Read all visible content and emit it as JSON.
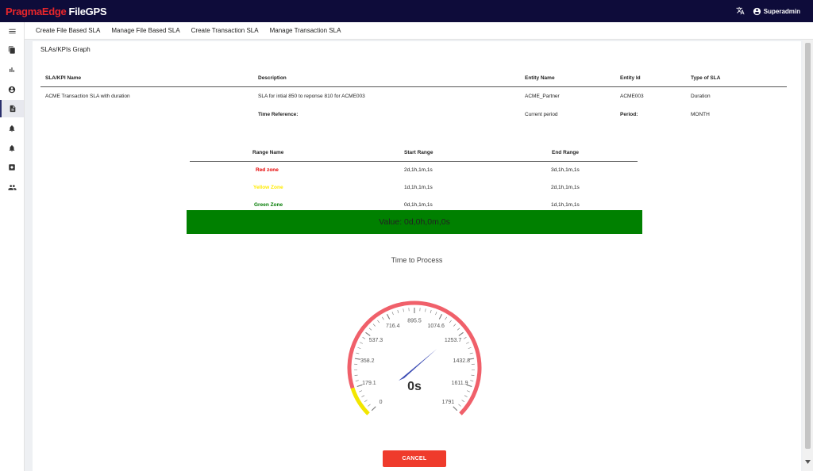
{
  "brand": {
    "part1": "PragmaEdge",
    "part2": "FileGPS"
  },
  "topbar": {
    "user": "Superadmin",
    "translate_icon": "translate-icon",
    "user_icon": "account-circle-icon"
  },
  "sidebar": {
    "items": [
      {
        "icon": "menu-icon"
      },
      {
        "icon": "file-icon"
      },
      {
        "icon": "bar-chart-icon"
      },
      {
        "icon": "account-icon"
      },
      {
        "icon": "document-icon",
        "active": true
      },
      {
        "icon": "bell-icon"
      },
      {
        "icon": "bell-alert-icon"
      },
      {
        "icon": "settings-box-icon"
      },
      {
        "icon": "people-icon"
      }
    ]
  },
  "nav": {
    "items": [
      {
        "label": "Create File Based SLA"
      },
      {
        "label": "Manage File Based SLA"
      },
      {
        "label": "Create Transaction SLA"
      },
      {
        "label": "Manage Transaction SLA"
      }
    ]
  },
  "page": {
    "title": "SLAs/KPIs Graph"
  },
  "sla": {
    "headers": {
      "name": "SLA/KPI Name",
      "description": "Description",
      "entity_name": "Entity Name",
      "entity_id": "Entity Id",
      "type": "Type of SLA"
    },
    "row": {
      "name": "ACME Transaction SLA with duration",
      "description": "SLA for intial 850 to reponse 810 for ACME003",
      "entity_name": "ACME_Partner",
      "entity_id": "ACME003",
      "type": "Duration"
    },
    "time_reference_label": "Time Reference:",
    "time_reference_value": "Current period",
    "period_label": "Period:",
    "period_value": "MONTH"
  },
  "ranges": {
    "headers": {
      "name": "Range Name",
      "start": "Start Range",
      "end": "End Range"
    },
    "rows": [
      {
        "name": "Red zone",
        "start": "2d,1h,1m,1s",
        "end": "3d,1h,1m,1s",
        "color": "#e60000"
      },
      {
        "name": "Yellow Zone",
        "start": "1d,1h,1m,1s",
        "end": "2d,1h,1m,1s",
        "color": "#ffeb00"
      },
      {
        "name": "Green Zone",
        "start": "0d,1h,1m,1s",
        "end": "1d,1h,1m,1s",
        "color": "#007a00"
      }
    ]
  },
  "value_bar": {
    "text": "Value: 0d,0h,0m,0s",
    "color": "#008000"
  },
  "chart_data": {
    "type": "gauge",
    "title": "Time to Process",
    "min": 0,
    "max": 1791,
    "ticks": [
      "0",
      "179.1",
      "358.2",
      "537.3",
      "716.4",
      "895.5",
      "1074.6",
      "1253.7",
      "1432.8",
      "1611.9",
      "1791"
    ],
    "value": 0,
    "value_label": "0s",
    "bands": [
      {
        "from": 0,
        "to": 0.1,
        "color": "#f2e600"
      },
      {
        "from": 0.1,
        "to": 1.0,
        "color": "#f0606a"
      }
    ],
    "needle_color": "#3f4fb5"
  },
  "buttons": {
    "cancel": "CANCEL"
  }
}
